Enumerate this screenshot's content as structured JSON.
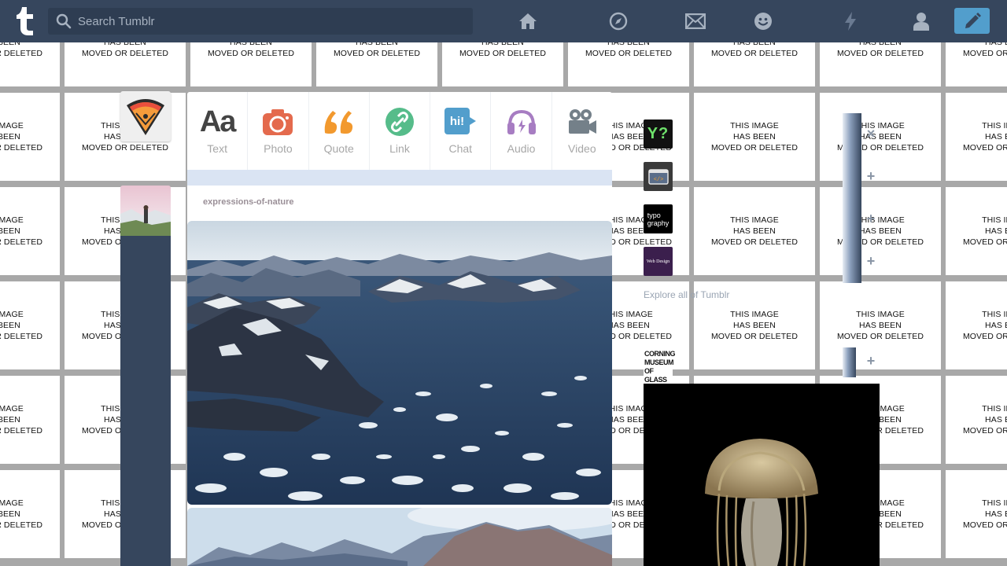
{
  "placeholder_text": "THIS IMAGE\nHAS BEEN\nMOVED OR DELETED",
  "header": {
    "search_placeholder": "Search Tumblr",
    "nav": [
      "home-icon",
      "explore-compass-icon",
      "inbox-mail-icon",
      "messaging-smiley-icon",
      "activity-lightning-icon",
      "account-person-icon"
    ],
    "compose": "compose-pencil-icon",
    "colors": {
      "bar": "#36465d",
      "search": "#2e3d52",
      "compose": "#529ecc"
    }
  },
  "composer": {
    "types": [
      {
        "label": "Text",
        "icon": "text-aa-icon",
        "color": "#444444"
      },
      {
        "label": "Photo",
        "icon": "camera-icon",
        "color": "#e46a4d"
      },
      {
        "label": "Quote",
        "icon": "quote-icon",
        "color": "#f2992e"
      },
      {
        "label": "Link",
        "icon": "link-icon",
        "color": "#56bc8a"
      },
      {
        "label": "Chat",
        "icon": "chat-icon",
        "color": "#529ecc"
      },
      {
        "label": "Audio",
        "icon": "headphones-icon",
        "color": "#a77dc2"
      },
      {
        "label": "Video",
        "icon": "video-camera-icon",
        "color": "#748089"
      }
    ]
  },
  "post": {
    "username": "expressions-of-nature"
  },
  "sidebar": {
    "recommended": [
      {
        "icon": "yes-no-blog-icon",
        "logo_text": "Y?"
      },
      {
        "icon": "code-blog-icon"
      },
      {
        "icon": "typography-blog-icon",
        "logo_text": "typo\ngraphy"
      },
      {
        "icon": "web-design-blog-icon",
        "logo_text": "Web Design"
      }
    ],
    "explore_label": "Explore all of Tumblr",
    "radar_blog_logo": "CORNING\nMUSEUM\nOF GLASS"
  }
}
